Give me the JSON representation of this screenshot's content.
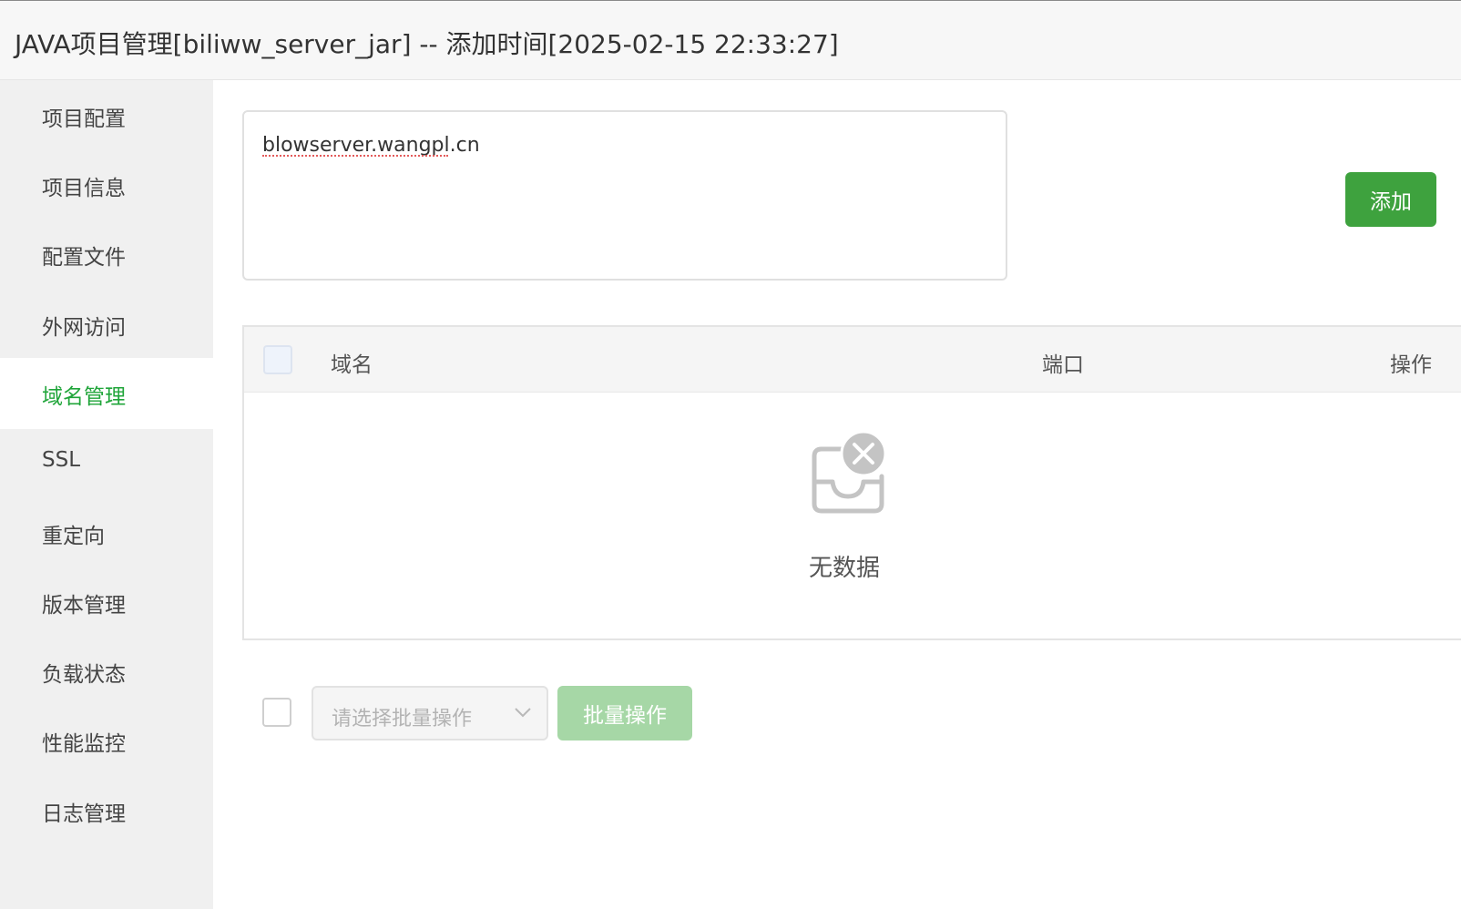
{
  "window": {
    "title": "JAVA项目管理[biliww_server_jar] -- 添加时间[2025-02-15 22:33:27]"
  },
  "sidebar": {
    "active_index": 4,
    "items": [
      {
        "label": "项目配置"
      },
      {
        "label": "项目信息"
      },
      {
        "label": "配置文件"
      },
      {
        "label": "外网访问"
      },
      {
        "label": "域名管理"
      },
      {
        "label": "SSL"
      },
      {
        "label": "重定向"
      },
      {
        "label": "版本管理"
      },
      {
        "label": "负载状态"
      },
      {
        "label": "性能监控"
      },
      {
        "label": "日志管理"
      }
    ]
  },
  "domain_input": {
    "value": "blowserver.wangpl.cn"
  },
  "add_button": {
    "label": "添加"
  },
  "table": {
    "columns": [
      "域名",
      "端口",
      "操作"
    ],
    "rows": [],
    "empty_text": "无数据"
  },
  "footer": {
    "batch_select_placeholder": "请选择批量操作",
    "batch_button_label": "批量操作"
  },
  "colors": {
    "accent_green": "#20a53a",
    "button_green": "#3ea23e",
    "button_green_disabled": "#a6d7a6",
    "sidebar_bg": "#f0f0f0"
  },
  "icons": {
    "empty_state": "empty-inbox-icon",
    "select_chevron": "chevron-down-icon"
  }
}
